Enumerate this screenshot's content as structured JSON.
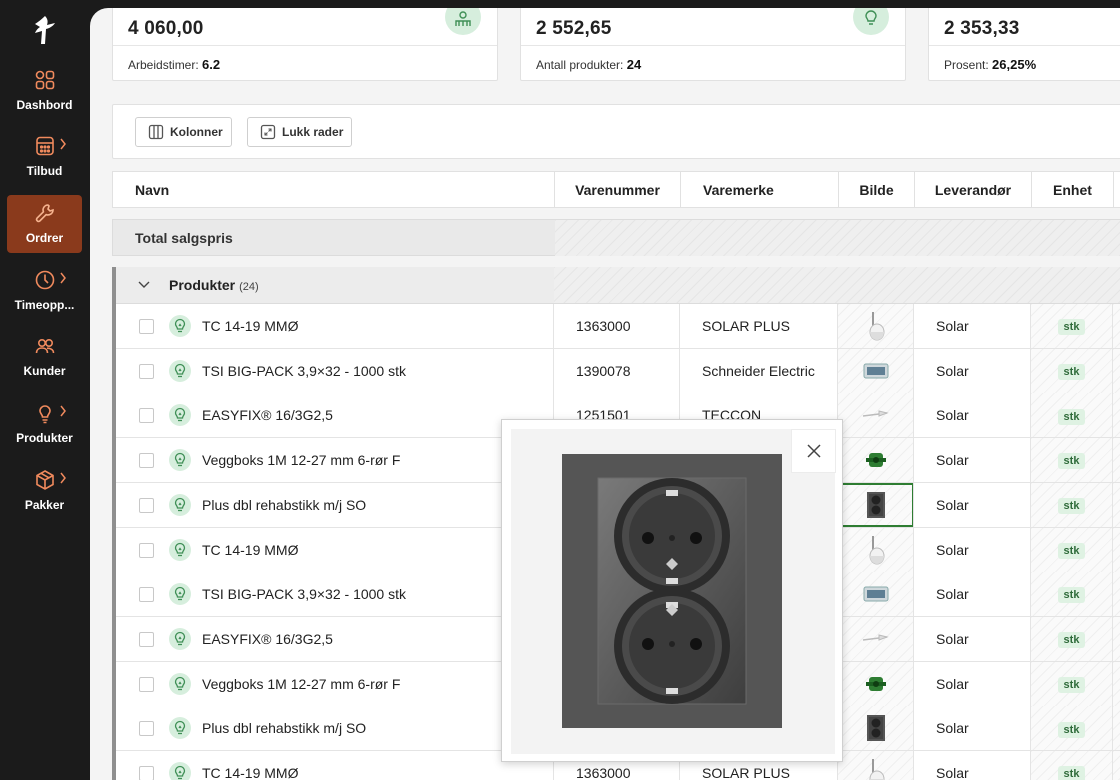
{
  "sidebar": {
    "items": [
      {
        "label": "Dashbord",
        "icon": "dashboard-grid-icon",
        "has_chevron": false,
        "active": false
      },
      {
        "label": "Tilbud",
        "icon": "calculator-icon",
        "has_chevron": true,
        "active": false
      },
      {
        "label": "Ordrer",
        "icon": "wrench-icon",
        "has_chevron": false,
        "active": true
      },
      {
        "label": "Timeopp...",
        "icon": "clock-icon",
        "has_chevron": true,
        "active": false
      },
      {
        "label": "Kunder",
        "icon": "users-icon",
        "has_chevron": false,
        "active": false
      },
      {
        "label": "Produkter",
        "icon": "lightbulb-icon",
        "has_chevron": true,
        "active": false
      },
      {
        "label": "Pakker",
        "icon": "package-icon",
        "has_chevron": true,
        "active": false
      }
    ],
    "accent_color": "#8a3a1c"
  },
  "summary_cards": [
    {
      "value": "4 060,00",
      "foot_label": "Arbeidstimer:",
      "foot_value": "6.2",
      "icon": "workers-icon"
    },
    {
      "value": "2 552,65",
      "foot_label": "Antall produkter:",
      "foot_value": "24",
      "icon": "lightbulb-icon"
    },
    {
      "value": "2 353,33",
      "foot_label": "Prosent:",
      "foot_value": "26,25%",
      "icon": ""
    }
  ],
  "toolbar": {
    "columns_label": "Kolonner",
    "collapse_label": "Lukk rader"
  },
  "table": {
    "headers": [
      "Navn",
      "Varenummer",
      "Varemerke",
      "Bilde",
      "Leverandør",
      "Enhet"
    ],
    "total_label": "Total salgspris",
    "group": {
      "label": "Produkter",
      "count": "(24)"
    },
    "rows": [
      {
        "name": "TC 14-19 MMØ",
        "varenummer": "1363000",
        "varemerke": "SOLAR PLUS",
        "image": "clip",
        "supplier": "Solar",
        "unit": "stk"
      },
      {
        "name": "TSI BIG-PACK 3,9×32 - 1000 stk",
        "varenummer": "1390078",
        "varemerke": "Schneider Electric",
        "image": "box",
        "supplier": "Solar",
        "unit": "stk"
      },
      {
        "name": "EASYFIX® 16/3G2,5",
        "varenummer": "1251501",
        "varemerke": "TECCON",
        "image": "cable",
        "supplier": "Solar",
        "unit": "stk"
      },
      {
        "name": "Veggboks 1M 12-27 mm 6-rør F",
        "varenummer": "",
        "varemerke": "",
        "image": "greenbox",
        "supplier": "Solar",
        "unit": "stk"
      },
      {
        "name": "Plus dbl rehabstikk m/j SO",
        "varenummer": "",
        "varemerke": "",
        "image": "socket",
        "supplier": "Solar",
        "unit": "stk",
        "selected": true
      },
      {
        "name": "TC 14-19 MMØ",
        "varenummer": "",
        "varemerke": "",
        "image": "clip",
        "supplier": "Solar",
        "unit": "stk"
      },
      {
        "name": "TSI BIG-PACK 3,9×32 - 1000 stk",
        "varenummer": "",
        "varemerke": "",
        "image": "box",
        "supplier": "Solar",
        "unit": "stk"
      },
      {
        "name": "EASYFIX® 16/3G2,5",
        "varenummer": "",
        "varemerke": "",
        "image": "cable",
        "supplier": "Solar",
        "unit": "stk"
      },
      {
        "name": "Veggboks 1M 12-27 mm 6-rør F",
        "varenummer": "",
        "varemerke": "",
        "image": "greenbox",
        "supplier": "Solar",
        "unit": "stk"
      },
      {
        "name": "Plus dbl rehabstikk m/j SO",
        "varenummer": "",
        "varemerke": "",
        "image": "socket",
        "supplier": "Solar",
        "unit": "stk"
      },
      {
        "name": "TC 14-19 MMØ",
        "varenummer": "1363000",
        "varemerke": "SOLAR PLUS",
        "image": "clip",
        "supplier": "Solar",
        "unit": "stk"
      }
    ]
  },
  "popup": {
    "image": "double-socket-image"
  }
}
